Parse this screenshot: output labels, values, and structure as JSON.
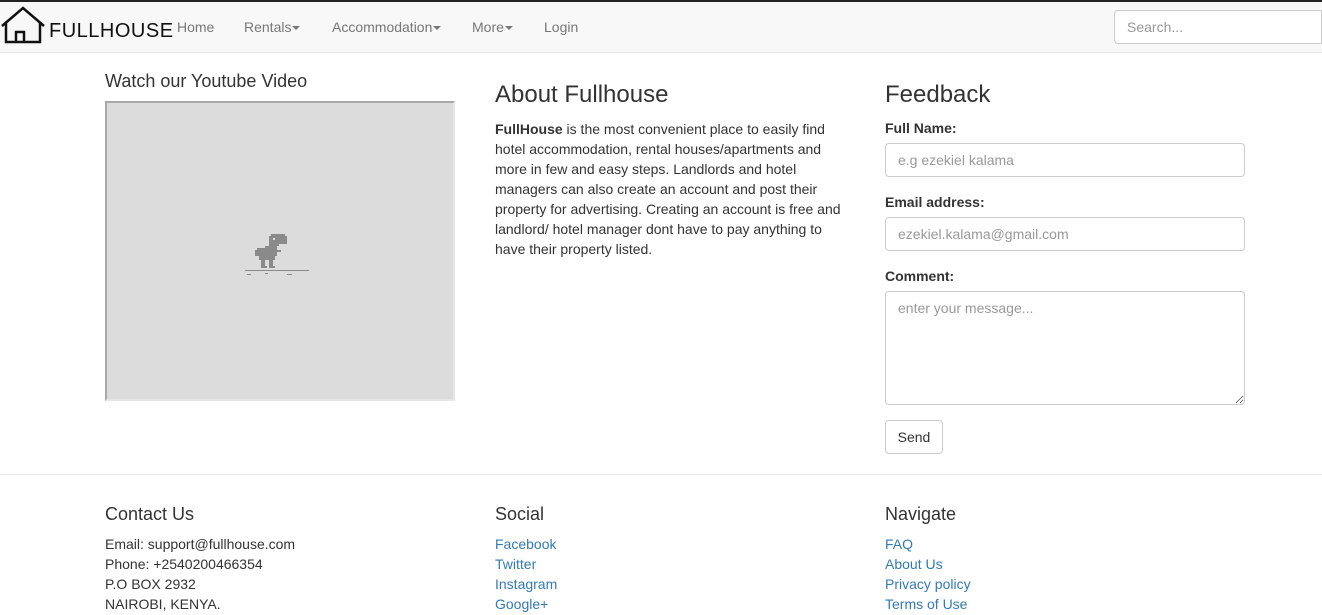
{
  "brand": {
    "name": "FULLHOUSE",
    "icon": "house-icon"
  },
  "nav": {
    "items": [
      {
        "label": "Home",
        "dropdown": false
      },
      {
        "label": "Rentals",
        "dropdown": true
      },
      {
        "label": "Accommodation",
        "dropdown": true
      },
      {
        "label": "More",
        "dropdown": true
      },
      {
        "label": "Login",
        "dropdown": false
      }
    ],
    "search_placeholder": "Search..."
  },
  "video": {
    "title": "Watch our Youtube Video",
    "icon": "offline-dino-icon"
  },
  "about": {
    "title": "About Fullhouse",
    "brand_word": "FullHouse",
    "text": " is the most convenient place to easily find hotel accommodation, rental houses/apartments and more in few and easy steps. Landlords and hotel managers can also create an account and post their property for advertising. Creating an account is free and landlord/ hotel manager dont have to pay anything to have their property listed."
  },
  "feedback": {
    "title": "Feedback",
    "name_label": "Full Name:",
    "name_placeholder": "e.g ezekiel kalama",
    "email_label": "Email address:",
    "email_placeholder": "ezekiel.kalama@gmail.com",
    "comment_label": "Comment:",
    "comment_placeholder": "enter your message...",
    "send_label": "Send"
  },
  "footer": {
    "contact": {
      "title": "Contact Us",
      "lines": [
        "Email: support@fullhouse.com",
        "Phone: +2540200466354",
        "P.O BOX 2932",
        "NAIROBI, KENYA."
      ]
    },
    "social": {
      "title": "Social",
      "links": [
        "Facebook",
        "Twitter",
        "Instagram",
        "Google+"
      ]
    },
    "navigate": {
      "title": "Navigate",
      "links": [
        "FAQ",
        "About Us",
        "Privacy policy",
        "Terms of Use"
      ]
    }
  },
  "colors": {
    "link": "#337ab7",
    "navbar_bg": "#f8f8f8",
    "text": "#333333"
  }
}
